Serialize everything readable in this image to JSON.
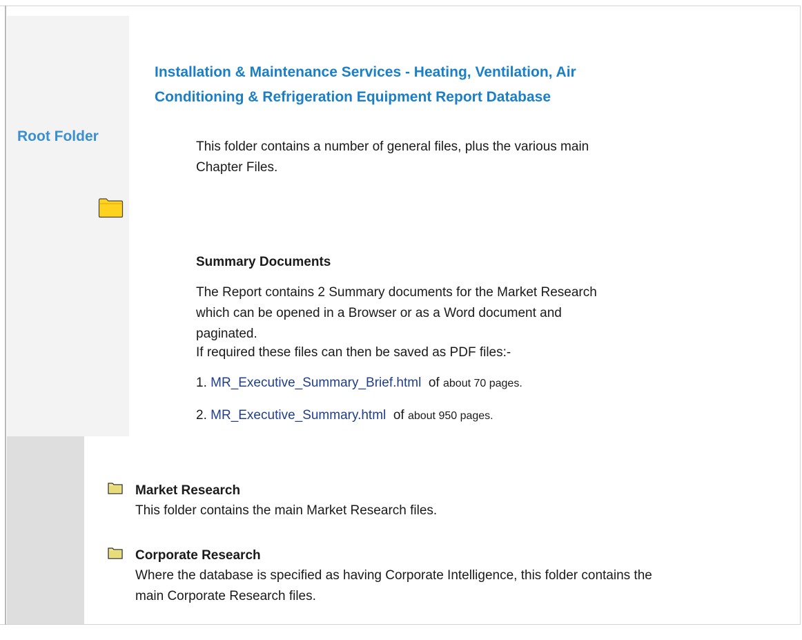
{
  "sidebar": {
    "root_label": "Root Folder"
  },
  "main": {
    "title": "Installation & Maintenance Services - Heating, Ventilation, Air Conditioning & Refrigeration Equipment Report Database",
    "intro": "This folder contains a number of general files, plus the various main Chapter Files.",
    "summary_heading": "Summary Documents",
    "summary_desc": "The Report contains 2 Summary documents for the Market Research which can be opened in a Browser or as a Word document and paginated.",
    "pdf_note": "If required these files can then be saved as PDF files:-",
    "files": [
      {
        "num": "1.",
        "link": "MR_Executive_Summary_Brief.html",
        "of": "of",
        "pages": "about 70 pages."
      },
      {
        "num": "2.",
        "link": "MR_Executive_Summary.html",
        "of": "of",
        "pages": "about 950 pages."
      }
    ]
  },
  "sections": [
    {
      "heading": "Market Research",
      "desc": "This folder contains the main Market Research files."
    },
    {
      "heading": "Corporate Research",
      "desc": "Where the database is specified as having Corporate Intelligence, this folder contains the main Corporate Research files."
    }
  ],
  "icons": {
    "root_folder": "folder-icon",
    "section_folder": "folder-icon"
  },
  "colors": {
    "title": "#1a7fc6",
    "root_label": "#3a8fce",
    "link": "#1f3f8a",
    "root_folder_fill": "#ffd21f",
    "section_folder_fill": "#f0e68c"
  }
}
